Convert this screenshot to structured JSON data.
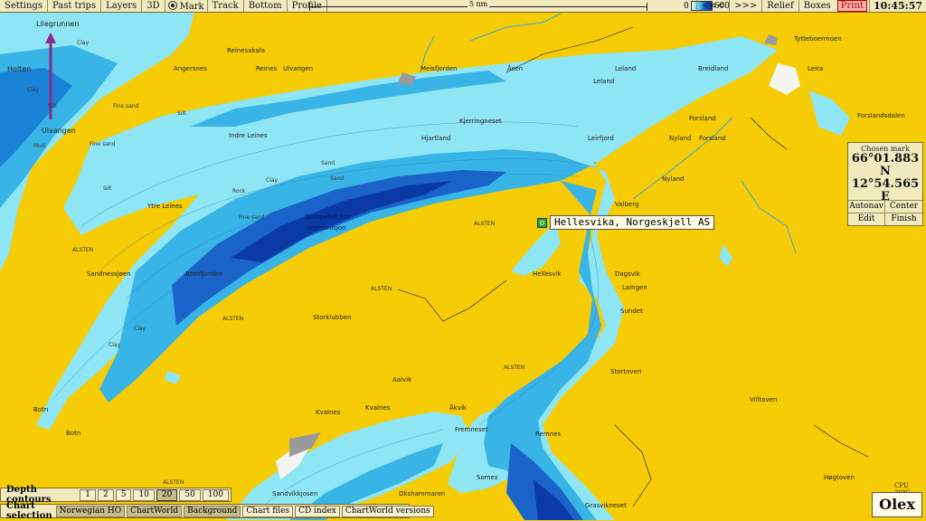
{
  "toolbar": {
    "settings": "Settings",
    "past_trips": "Past trips",
    "layers": "Layers",
    "view_3d": "3D",
    "mark": "Mark",
    "track": "Track",
    "bottom": "Bottom",
    "profile": "Profile",
    "scale_label": "5 nm",
    "depth_min": "0",
    "depth_max": "600",
    "nav_back": "<<<",
    "nav_forward": ">>>",
    "relief": "Relief",
    "boxes": "Boxes",
    "print": "Print",
    "clock": "10:45:57"
  },
  "chosen_mark": {
    "header": "Chosen mark",
    "lat": "66°01.883 N",
    "lon": "12°54.565 E",
    "autonav": "Autonav",
    "center": "Center",
    "edit": "Edit",
    "finish": "Finish"
  },
  "placemark": {
    "label": "Hellesvika, Norgeskjell AS"
  },
  "depth_contours": {
    "title": "Depth contours",
    "options": [
      "1",
      "2",
      "5",
      "10",
      "20",
      "50",
      "100"
    ],
    "selected": "20"
  },
  "chart_selection": {
    "title": "Chart selection",
    "norwegian_ho": "Norwegian HO",
    "chartworld": "ChartWorld",
    "background": "Background",
    "chart_files": "Chart files",
    "cd_index": "CD index",
    "chartworld_versions": "ChartWorld versions"
  },
  "cpu": "CPU 36°C",
  "logo": "Olex",
  "map": {
    "colors": {
      "land": "#f5cc05",
      "shallow": "#8ee5f3",
      "mid": "#39b4e6",
      "deep": "#1a63c8",
      "deepest": "#0b3aa6",
      "intertidal": "#f4f4f0"
    },
    "places": {
      "lovegrunnen": "Lilegrunnen",
      "holten": "Holten",
      "ulvangen_w": "Ulvangen",
      "reinesaksla": "Reinesakala",
      "angersnes": "Angersnes",
      "reines": "Reines",
      "ulvangen": "Ulvangen",
      "meisfjorden": "Meisfjorden",
      "asen": "Åsen",
      "leland": "Leland",
      "leland2": "Leland",
      "breidland": "Breidland",
      "tytteboermoen": "Tytteboermoen",
      "leira": "Leira",
      "forslandsdalen": "Forslandsdalen",
      "indre_leines": "Indre Leines",
      "kjerringneset": "Kjerringneset",
      "hjartland": "Hjartland",
      "leirfjord": "Leirfjord",
      "forsland": "Forsland",
      "nyland": "Nyland",
      "forsland2": "Forsland",
      "nyland2": "Nyland",
      "ytre_leines": "Ytre Leines",
      "dumpefelt": "Dumpefelt For",
      "ammunisjon": "Ammunisjon",
      "valberg": "Valberg",
      "alsten_n": "ALSTEN",
      "sandnessjoen": "Sandnessjøen",
      "botnfjorden": "Botnfjorden",
      "hellesvik": "Hellesvik",
      "dagsvik": "Dagsvik",
      "laingen": "Laingen",
      "alsten_c": "ALSTEN",
      "storklubben": "Storklubben",
      "alsten_w": "ALSTEN",
      "alsten_l": "ALSTEN",
      "sundet": "Sundet",
      "alsten_s": "ALSTEN",
      "aalvik": "Aalvik",
      "stortoven": "Stortoven",
      "villtoven": "Villtoven",
      "botn": "Botn",
      "botn2": "Botn",
      "kvalnes": "Kvalnes",
      "kvalnes2": "Kvalnes",
      "akvik": "Åkvik",
      "fremneset": "Fremneset",
      "remnes": "Remnes",
      "somes": "Somes",
      "sandvikkjosen": "Sandvikkjosen",
      "okshammaren": "Okshammaren",
      "grasvikneset": "Grasvikneset",
      "hogtoven": "Høgtoven",
      "alsten_b": "ALSTEN"
    },
    "seabed": {
      "fine_sand": "Fine sand",
      "clay": "Clay",
      "silt": "Silt",
      "sand": "Sand",
      "mud": "Mud",
      "rock": "Rock"
    }
  }
}
